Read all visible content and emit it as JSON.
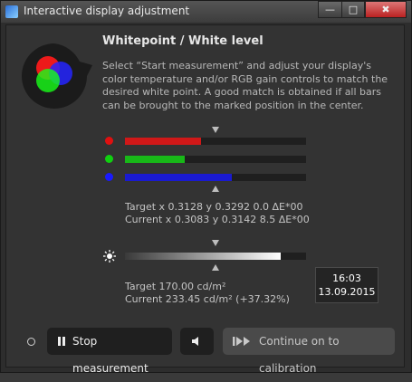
{
  "window": {
    "title": "Interactive display adjustment",
    "controls": {
      "minimize": "—",
      "maximize": "□",
      "close": "✖"
    }
  },
  "header": {
    "icon": "rgb-circles-icon",
    "title": "Whitepoint / White level",
    "description": "Select “Start measurement” and adjust your display's color temperature and/or RGB gain controls to match the desired white point. A good match is obtained if all bars can be brought to the marked position in the center."
  },
  "rgb_bars": [
    {
      "name": "red",
      "color": "#e01010",
      "bar_color": "#d01818",
      "level": 0.42
    },
    {
      "name": "green",
      "color": "#10d010",
      "bar_color": "#18b818",
      "level": 0.33
    },
    {
      "name": "blue",
      "color": "#1a1aff",
      "bar_color": "#1a1ad0",
      "level": 0.59
    }
  ],
  "whitepoint": {
    "target": "Target x 0.3128 y 0.3292 0.0 ΔE*00",
    "current": "Current x 0.3083 y 0.3142 8.5 ΔE*00"
  },
  "luminance": {
    "icon": "sun-icon",
    "level": 0.86,
    "target": "Target 170.00 cd/m²",
    "current": "Current 233.45 cd/m² (+37.32%)"
  },
  "clock": {
    "time": "16:03",
    "date": "13.09.2015"
  },
  "footer": {
    "stop_label": "Stop measurement",
    "continue_label": "Continue on to calibration"
  },
  "colors": {
    "background": "#333333",
    "button": "#1f1f1f",
    "disabled_button": "#4a4a4a"
  }
}
